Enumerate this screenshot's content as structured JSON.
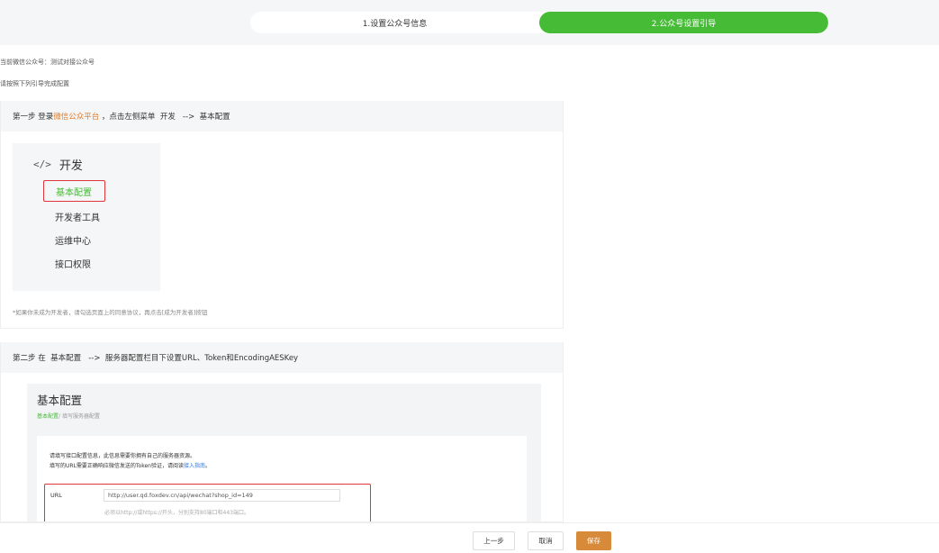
{
  "steps": [
    {
      "label": "1.设置公众号信息",
      "active": false
    },
    {
      "label": "2.公众号设置引导",
      "active": true
    }
  ],
  "info": {
    "current_account": "当前微信公众号：测试对接公众号",
    "instruction": "请按照下列引导完成配置"
  },
  "step1": {
    "prefix": "第一步 登录",
    "platform_link": "微信公众平台",
    "suffix": " ，点击左侧菜单  开发   -->  基本配置",
    "menu_title": "开发",
    "menu_icon": "</>",
    "menu_items": [
      "基本配置",
      "开发者工具",
      "运维中心",
      "接口权限"
    ],
    "note": "*如果你未成为开发者，请勾选页面上的同意协议，再点击[成为开发者]按钮"
  },
  "step2": {
    "heading": "第二步 在  基本配置   -->  服务器配置栏目下设置URL、Token和EncodingAESKey",
    "cfg_title": "基本配置",
    "crumb_active": "基本配置",
    "crumb_rest": "/ 填写服务器配置",
    "desc1": "请填写接口配置信息，此信息需要你拥有自己的服务器资源。",
    "desc2_prefix": "填写的URL需要正确响应微信发送的Token验证，请阅读",
    "desc2_link": "接入指南",
    "desc2_suffix": "。",
    "url_label": "URL",
    "url_value": "http://user.qd.foxdev.cn/api/wechat?shop_id=149",
    "url_hint": "必须以http://或https://开头，分别支持80端口和443端口。"
  },
  "footer": {
    "prev": "上一步",
    "cancel": "取消",
    "save": "保存"
  },
  "colors": {
    "accent_green": "#46bb36",
    "save_orange": "#d68a3a",
    "highlight_red": "#e0353b",
    "link_orange": "#e07a24"
  }
}
